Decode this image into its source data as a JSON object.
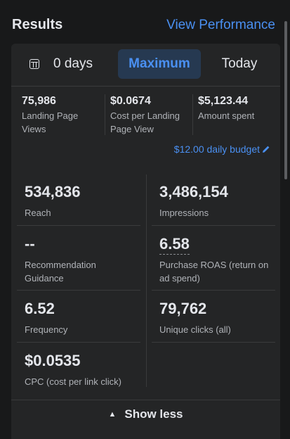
{
  "header": {
    "title": "Results",
    "view_performance": "View Performance"
  },
  "tabs": [
    {
      "label": "0 days",
      "icon": "calendar-icon"
    },
    {
      "label": "Maximum",
      "active": true
    },
    {
      "label": "Today"
    }
  ],
  "summary": [
    {
      "value": "75,986",
      "label": "Landing Page Views"
    },
    {
      "value": "$0.0674",
      "label": "Cost per Landing Page View"
    },
    {
      "value": "$5,123.44",
      "label": "Amount spent"
    }
  ],
  "budget": {
    "label": "$12.00 daily budget",
    "icon": "pencil-icon"
  },
  "metrics": [
    {
      "value": "534,836",
      "label": "Reach"
    },
    {
      "value": "3,486,154",
      "label": "Impressions"
    },
    {
      "value": "--",
      "label": "Recommendation Guidance"
    },
    {
      "value": "6.58",
      "label": "Purchase ROAS (return on ad spend)"
    },
    {
      "value": "6.52",
      "label": "Frequency"
    },
    {
      "value": "79,762",
      "label": "Unique clicks (all)"
    },
    {
      "value": "$0.0535",
      "label": "CPC (cost per link click)"
    }
  ],
  "footer": {
    "show_less": "Show less",
    "icon": "chevron-up-icon"
  },
  "colors": {
    "accent": "#4a90f2",
    "background": "#18191a",
    "card": "#242526"
  }
}
